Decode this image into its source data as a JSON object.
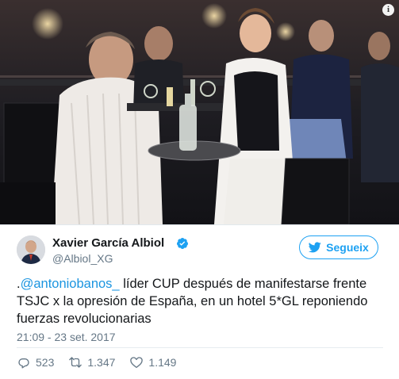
{
  "photo": {
    "info_glyph": "i",
    "description": "restaurant-photo"
  },
  "author": {
    "name": "Xavier García Albiol",
    "handle": "@Albiol_XG",
    "verified": true,
    "avatar_icon": "avatar"
  },
  "follow_button": {
    "label": "Segueix",
    "icon": "twitter-bird-icon",
    "color": "#1da1f2"
  },
  "tweet": {
    "prefix": ".",
    "mention": "@antoniobanos_",
    "text": " líder CUP después de manifestarse frente TSJC x la opresión de España, en un hotel 5*GL reponiendo fuerzas revolucionarias"
  },
  "timestamp": "21:09 - 23 set. 2017",
  "actions": {
    "replies": "523",
    "retweets": "1.347",
    "likes": "1.149"
  },
  "colors": {
    "accent": "#1da1f2",
    "link": "#1b95e0",
    "muted": "#657786"
  }
}
